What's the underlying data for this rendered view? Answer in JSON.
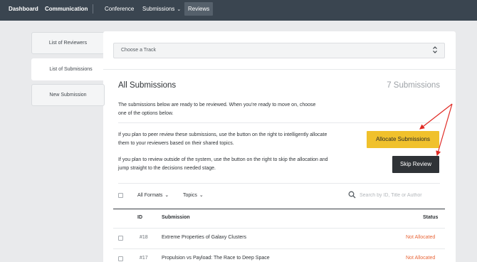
{
  "topnav": {
    "dashboard": "Dashboard",
    "communication": "Communication",
    "conference": "Conference",
    "submissions": "Submissions",
    "reviews": "Reviews"
  },
  "sidebar": {
    "items": [
      {
        "label": "List of Reviewers"
      },
      {
        "label": "List of Submissions"
      },
      {
        "label": "New Submission"
      }
    ]
  },
  "track": {
    "placeholder": "Choose a Track"
  },
  "main": {
    "title": "All Submissions",
    "count": "7 Submissions",
    "intro": "The submissions below are ready to be reviewed. When you’re ready to move on, choose one of the options below.",
    "peer_text": "If you plan to peer review these submissions, use the button on the right to intelligently allocate them to your reviewers based on their shared topics.",
    "skip_text": "If you plan to review outside of the system, use the button on the right to skip the allocation and jump straight to the decisions needed stage.",
    "allocate_label": "Allocate Submissions",
    "skip_label": "Skip Review"
  },
  "filters": {
    "formats": "All Formats",
    "topics": "Topics",
    "search_placeholder": "Search by ID, Title or Author"
  },
  "table": {
    "headers": {
      "id": "ID",
      "submission": "Submission",
      "status": "Status"
    },
    "rows": [
      {
        "id": "#18",
        "title": "Extreme Properties of Galaxy Clusters",
        "status": "Not Allocated"
      },
      {
        "id": "#17",
        "title": "Propulsion vs Payload: The Race to Deep Space",
        "status": "Not Allocated"
      }
    ]
  },
  "colors": {
    "topbar": "#3a4550",
    "accent_yellow": "#f0c12c",
    "status_orange": "#e8673a",
    "annotation_red": "#e02a24"
  }
}
